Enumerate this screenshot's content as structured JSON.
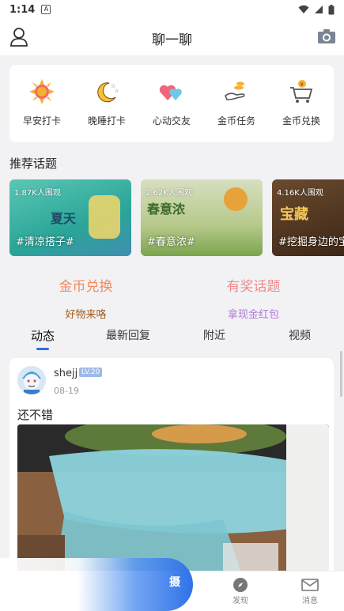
{
  "status_bar": {
    "time": "1:14",
    "notification_glyph": "A"
  },
  "header": {
    "title": "聊一聊",
    "left_icon": "user-icon",
    "right_icon": "camera-icon"
  },
  "checkin": {
    "items": [
      {
        "label": "早安打卡",
        "icon": "sun-icon"
      },
      {
        "label": "晚睡打卡",
        "icon": "moon-icon"
      },
      {
        "label": "心动交友",
        "icon": "hearts-icon"
      },
      {
        "label": "金币任务",
        "icon": "coin-hand-icon"
      },
      {
        "label": "金币兑换",
        "icon": "shopping-cart-icon"
      }
    ]
  },
  "recommended": {
    "title": "推荐话题",
    "topics": [
      {
        "views": "1.87K人围观",
        "name": "#清凉搭子#",
        "deco": "夏天",
        "color": "#3fb8a8"
      },
      {
        "views": "2.62K人围观",
        "name": "#春意浓#",
        "deco": "春意浓",
        "color": "#c9d6a6"
      },
      {
        "views": "4.16K人围观",
        "name": "#挖掘身边的宝",
        "deco": "宝藏",
        "color": "#5a3b22"
      }
    ]
  },
  "promos": [
    {
      "title": "金币兑换",
      "subtitle": "好物来咯",
      "title_color": "#f08a5d",
      "subtitle_color": "#a25a1a"
    },
    {
      "title": "有奖话题",
      "subtitle": "拿现金红包",
      "title_color": "#f08a8a",
      "subtitle_color": "#b07ad6"
    }
  ],
  "tabs": {
    "active": "动态",
    "items": [
      "动态",
      "最新回复",
      "附近",
      "视频"
    ]
  },
  "post": {
    "username": "shejj",
    "level": "LV.20",
    "date": "08-19",
    "text": "还不错"
  },
  "bottom_nav": {
    "fab_label": "摄",
    "items": [
      {
        "label": "发现",
        "icon": "compass-icon"
      },
      {
        "label": "消息",
        "icon": "mail-icon"
      }
    ]
  },
  "colors": {
    "accent": "#2f6fe0",
    "background": "#f2f2f4"
  }
}
